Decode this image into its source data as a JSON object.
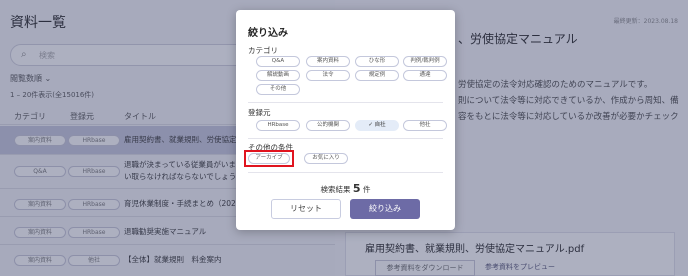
{
  "page": {
    "title": "資料一覧",
    "search_placeholder": "検索",
    "sort_label": "閲覧数順 ⌄",
    "count_text": "1 – 20件表示(全15016件)",
    "columns": [
      "カテゴリ",
      "登録元",
      "タイトル"
    ],
    "rows": [
      {
        "category": "案内資料",
        "source": "HRbase",
        "title": "雇用契約書、就業規則、労使協定マ"
      },
      {
        "category": "Q&A",
        "source": "HRbase",
        "title": "退職が決まっている従業員がいま"
      },
      {
        "category": "",
        "source": "",
        "title": "い取らなければならないでしょうか?"
      },
      {
        "category": "案内資料",
        "source": "HRbase",
        "title": "育児休業制度・手続まとめ（2022"
      },
      {
        "category": "案内資料",
        "source": "HRbase",
        "title": "退職勧奨実施マニュアル"
      },
      {
        "category": "案内資料",
        "source": "他社",
        "title": "【全体】就業規則　料金案内"
      }
    ]
  },
  "preview": {
    "date": "最終更新：2023.08.18",
    "title": "、労使協定マニュアル",
    "lines": [
      "労使協定の法令対応確認のためのマニュアルです。",
      "則について法令等に対応できているか、作成から周知、備",
      "容をもとに法令等に対応しているか改善が必要かチェック"
    ],
    "file_name": "雇用契約書、就業規則、労使協定マニュアル.pdf",
    "download_label": "参考資料をダウンロード",
    "preview_label": "参考資料をプレビュー"
  },
  "modal": {
    "title": "絞り込み",
    "category_heading": "カテゴリ",
    "categories": [
      "Q&A",
      "案内資料",
      "ひな形",
      "判例/裁判例",
      "解説動画",
      "法令",
      "規定例",
      "通達",
      "その他"
    ],
    "source_heading": "登録元",
    "sources": [
      "HRbase",
      "公的機関",
      "✓ 自社",
      "他社"
    ],
    "other_heading": "その他の条件",
    "others": [
      "アーカイブ",
      "お気に入り"
    ],
    "result_prefix": "検索結果",
    "result_count": "5",
    "result_suffix": "件",
    "reset_label": "リセット",
    "apply_label": "絞り込み"
  },
  "colors": {
    "accent": "#6d6ba6",
    "highlight": "#e0141f",
    "selected_chip": "#e4ecf8"
  }
}
